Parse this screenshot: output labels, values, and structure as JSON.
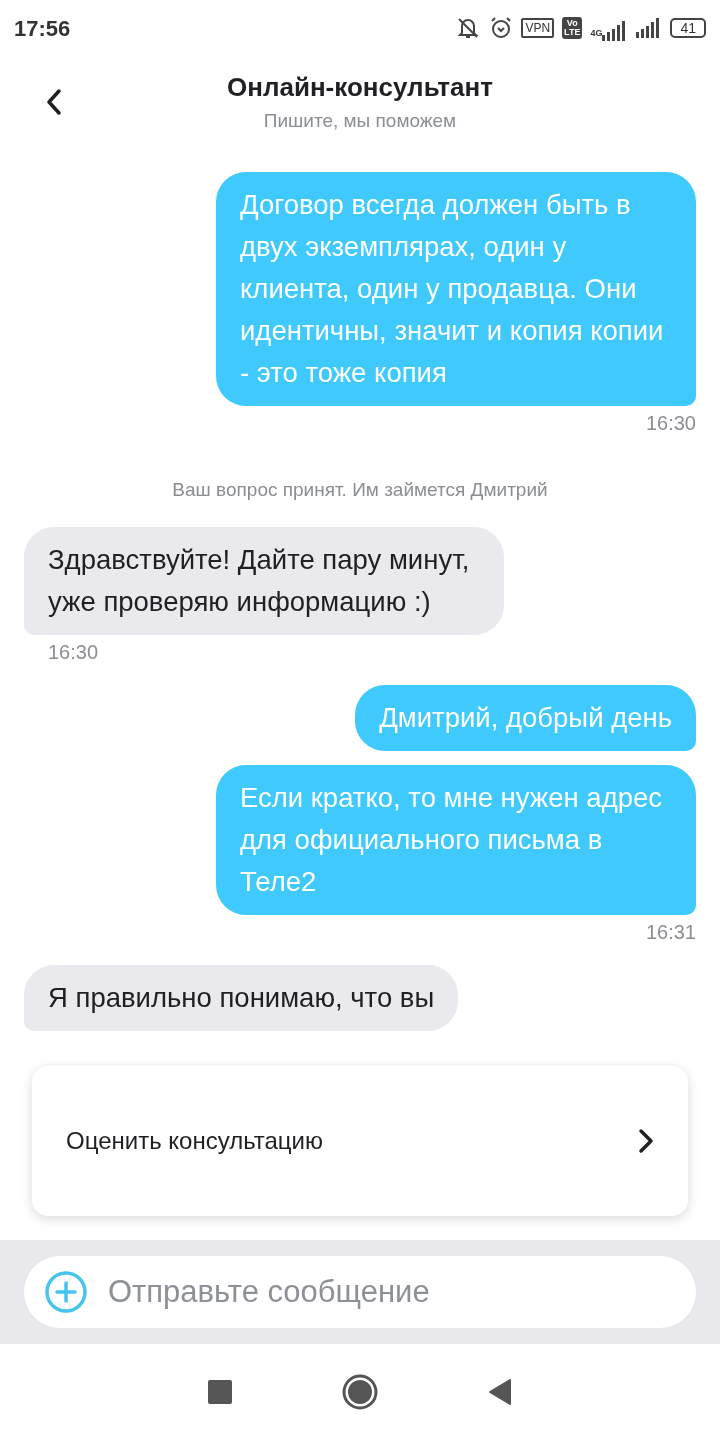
{
  "status_bar": {
    "time": "17:56",
    "vpn": "VPN",
    "volte": [
      "Vo",
      "LTE"
    ],
    "network": "4G",
    "battery": "41"
  },
  "header": {
    "title": "Онлайн-консультант",
    "subtitle": "Пишите, мы поможем"
  },
  "messages": [
    {
      "kind": "outgoing",
      "text": "Договор всегда должен быть в двух экземплярах, один у клиента, один у продавца. Они идентичны, значит и копия копии - это тоже копия",
      "time": "16:30"
    },
    {
      "kind": "system",
      "text": "Ваш вопрос принят. Им займется Дмитрий"
    },
    {
      "kind": "incoming",
      "text": "Здравствуйте!  Дайте пару минут, уже проверяю информацию :)",
      "time": "16:30"
    },
    {
      "kind": "outgoing",
      "text": "Дмитрий, добрый день"
    },
    {
      "kind": "outgoing",
      "text": "Если кратко, то мне нужен адрес для официального письма в Теле2",
      "time": "16:31"
    },
    {
      "kind": "incoming",
      "text": "Я правильно понимаю, что вы"
    }
  ],
  "rating_card": {
    "label": "Оценить консультацию"
  },
  "composer": {
    "placeholder": "Отправьте сообщение"
  }
}
